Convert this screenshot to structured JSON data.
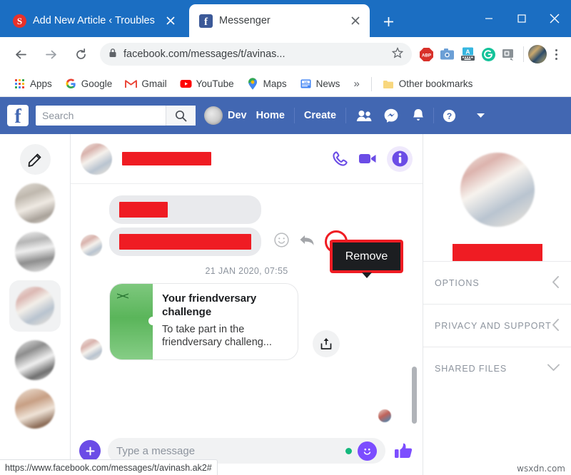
{
  "browser": {
    "tabs": [
      {
        "title": "Add New Article ‹ Troubles",
        "favicon": "red-circle-icon",
        "active": false
      },
      {
        "title": "Messenger",
        "favicon": "facebook-icon",
        "active": true
      }
    ],
    "new_tab_label": "+",
    "window_controls": {
      "minimize": "minimize-icon",
      "maximize": "maximize-icon",
      "close": "close-icon"
    },
    "nav": {
      "back": "back-arrow-icon",
      "forward": "forward-arrow-icon",
      "reload": "reload-icon"
    },
    "omnibox": {
      "lock": "lock-icon",
      "url": "facebook.com/messages/t/avinas...",
      "star": "star-icon"
    },
    "extensions": [
      "adblock-plus-icon",
      "camera-icon",
      "keyboard-icon",
      "grammarly-icon",
      "screenshot-icon"
    ],
    "profile_avatar": "browser-profile-avatar",
    "menu": "three-dot-menu-icon",
    "bookmarks": [
      {
        "label": "Apps",
        "icon": "apps-grid-icon"
      },
      {
        "label": "Google",
        "icon": "google-icon"
      },
      {
        "label": "Gmail",
        "icon": "gmail-icon"
      },
      {
        "label": "YouTube",
        "icon": "youtube-icon"
      },
      {
        "label": "Maps",
        "icon": "maps-pin-icon"
      },
      {
        "label": "News",
        "icon": "google-news-icon"
      }
    ],
    "bookmarks_overflow": "»",
    "other_bookmarks": "Other bookmarks",
    "status_url": "https://www.facebook.com/messages/t/avinash.ak2#"
  },
  "facebook_bar": {
    "logo": "f",
    "search_placeholder": "Search",
    "search_button": "search-icon",
    "profile_name": "Dev",
    "links": [
      "Home",
      "Create"
    ],
    "icons": [
      "friend-requests-icon",
      "messenger-icon",
      "notifications-icon",
      "help-icon"
    ],
    "caret": "chevron-down-icon"
  },
  "messenger": {
    "compose_button": "compose-icon",
    "conversation_count": 5,
    "header": {
      "avatar": "contact-avatar",
      "name_redacted": true,
      "call_icon": "phone-icon",
      "video_icon": "video-camera-icon",
      "info_icon": "info-icon"
    },
    "messages": [
      {
        "type": "redacted-bubble",
        "width": 68
      },
      {
        "type": "redacted-bubble",
        "width": 185
      }
    ],
    "message_tools": {
      "emoji": "emoji-icon",
      "reply": "reply-arrow-icon",
      "more": "more-options-icon",
      "tooltip": "Remove"
    },
    "timestamp": "21 JAN 2020, 07:55",
    "card": {
      "title": "Your friendversary challenge",
      "body": "To take part in the friendversary challeng...",
      "share_icon": "share-icon"
    },
    "composer": {
      "add_icon": "plus-icon",
      "placeholder": "Type a message",
      "emoji_icon": "smiley-icon",
      "like_icon": "thumbs-up-icon"
    }
  },
  "info_panel": {
    "avatar": "contact-large-avatar",
    "name_redacted": true,
    "sections": [
      {
        "label": "OPTIONS",
        "chevron": "chevron-left-icon"
      },
      {
        "label": "PRIVACY AND SUPPORT",
        "chevron": "chevron-left-icon"
      },
      {
        "label": "SHARED FILES",
        "chevron": "chevron-down-icon"
      }
    ]
  },
  "watermark": "wsxdn.com",
  "colors": {
    "browser_blue": "#1b6ec2",
    "facebook_blue": "#4267b2",
    "messenger_purple": "#6b4ce6",
    "redaction_red": "#ef1c23",
    "tooltip_bg": "#1c1e21"
  }
}
